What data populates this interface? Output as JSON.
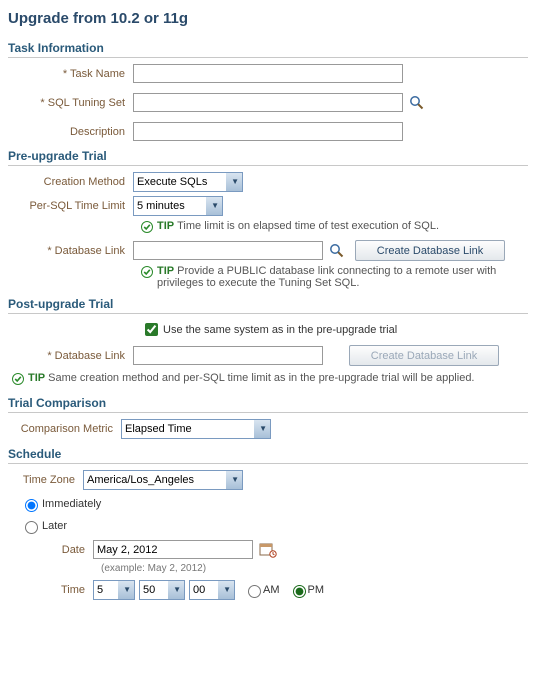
{
  "page_title": "Upgrade from 10.2 or 11g",
  "task_info": {
    "header": "Task Information",
    "task_name_label": "* Task Name",
    "task_name_value": "",
    "sts_label": "* SQL Tuning Set",
    "sts_value": "",
    "description_label": "Description",
    "description_value": ""
  },
  "pre_upgrade": {
    "header": "Pre-upgrade Trial",
    "creation_method_label": "Creation Method",
    "creation_method_value": "Execute SQLs",
    "per_sql_limit_label": "Per-SQL Time Limit",
    "per_sql_limit_value": "5 minutes",
    "tip1_label": "TIP",
    "tip1_text": "Time limit is on elapsed time of test execution of SQL.",
    "dblink_label": "* Database Link",
    "dblink_value": "",
    "create_dblink_btn": "Create Database Link",
    "tip2_label": "TIP",
    "tip2_text": "Provide a PUBLIC database link connecting to a remote user with privileges to execute the Tuning Set SQL."
  },
  "post_upgrade": {
    "header": "Post-upgrade Trial",
    "same_system_label": "Use the same system as in the pre-upgrade trial",
    "same_system_checked": true,
    "dblink_label": "* Database Link",
    "dblink_value": "",
    "create_dblink_btn": "Create Database Link",
    "tip_label": "TIP",
    "tip_text": "Same creation method and per-SQL time limit as in the pre-upgrade trial will be applied."
  },
  "comparison": {
    "header": "Trial Comparison",
    "metric_label": "Comparison Metric",
    "metric_value": "Elapsed Time"
  },
  "schedule": {
    "header": "Schedule",
    "tz_label": "Time Zone",
    "tz_value": "America/Los_Angeles",
    "immediately_label": "Immediately",
    "later_label": "Later",
    "selected": "immediately",
    "date_label": "Date",
    "date_value": "May 2, 2012",
    "date_example": "(example: May 2, 2012)",
    "time_label": "Time",
    "hour_value": "5",
    "minute_value": "50",
    "second_value": "00",
    "am_label": "AM",
    "pm_label": "PM",
    "ampm_selected": "PM"
  }
}
